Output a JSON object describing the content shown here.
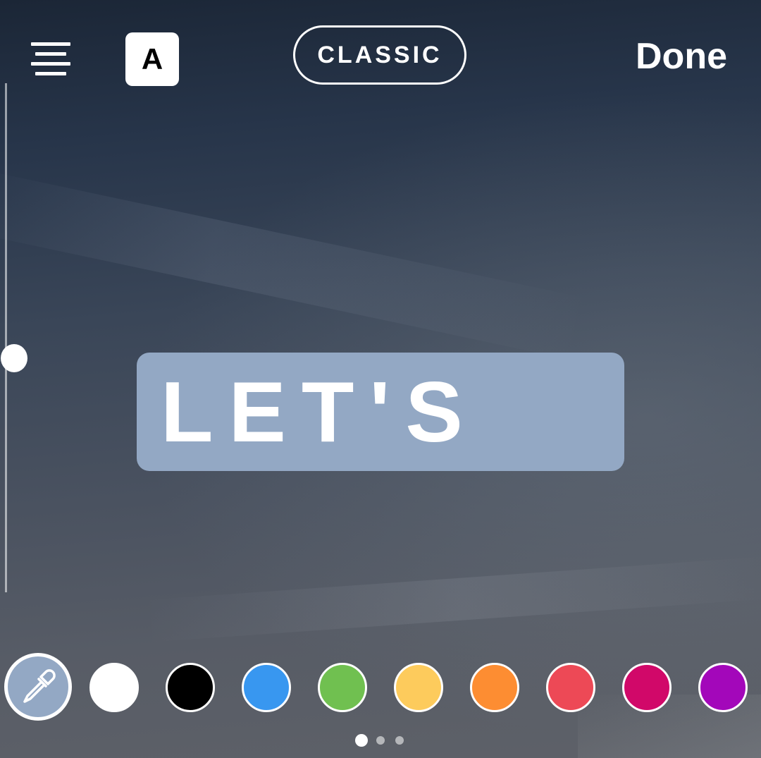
{
  "toolbar": {
    "align_icon": "align-center-icon",
    "font_label": "A",
    "style_label": "CLASSIC",
    "done_label": "Done"
  },
  "slider": {
    "level": 0.46
  },
  "text_box": {
    "text": "LET'S",
    "background_color": "#93a8c4"
  },
  "palette": {
    "eyedropper_icon": "eyedropper-icon",
    "colors": [
      "#ffffff",
      "#000000",
      "#3897f0",
      "#70c050",
      "#fdcb5c",
      "#fd8d32",
      "#ed4956",
      "#d10869",
      "#a307ba"
    ]
  },
  "pagination": {
    "pages": 3,
    "active": 1
  }
}
